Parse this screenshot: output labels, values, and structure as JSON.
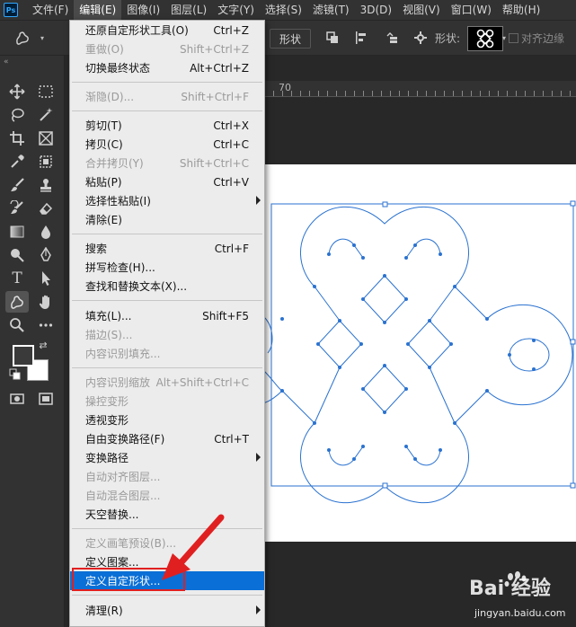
{
  "menubar": {
    "app_icon": "ps",
    "items": [
      "文件(F)",
      "编辑(E)",
      "图像(I)",
      "图层(L)",
      "文字(Y)",
      "选择(S)",
      "滤镜(T)",
      "3D(D)",
      "视图(V)",
      "窗口(W)",
      "帮助(H)"
    ],
    "active_index": 1
  },
  "options": {
    "shape_button": "形状",
    "shape_label": "形状:",
    "align_edges": "对齐边缘"
  },
  "ruler": {
    "number": "70"
  },
  "edit_menu": {
    "items": [
      {
        "label": "还原自定形状工具(O)",
        "shortcut": "Ctrl+Z",
        "disabled": false
      },
      {
        "label": "重做(O)",
        "shortcut": "Shift+Ctrl+Z",
        "disabled": true
      },
      {
        "label": "切换最终状态",
        "shortcut": "Alt+Ctrl+Z",
        "disabled": false
      },
      {
        "label": "渐隐(D)...",
        "shortcut": "Shift+Ctrl+F",
        "disabled": true
      },
      {
        "label": "剪切(T)",
        "shortcut": "Ctrl+X",
        "disabled": false
      },
      {
        "label": "拷贝(C)",
        "shortcut": "Ctrl+C",
        "disabled": false
      },
      {
        "label": "合并拷贝(Y)",
        "shortcut": "Shift+Ctrl+C",
        "disabled": true
      },
      {
        "label": "粘贴(P)",
        "shortcut": "Ctrl+V",
        "disabled": false
      },
      {
        "label": "选择性粘贴(I)",
        "shortcut": "",
        "disabled": false,
        "submenu": true
      },
      {
        "label": "清除(E)",
        "shortcut": "",
        "disabled": false
      },
      {
        "label": "搜索",
        "shortcut": "Ctrl+F",
        "disabled": false
      },
      {
        "label": "拼写检查(H)...",
        "shortcut": "",
        "disabled": false
      },
      {
        "label": "查找和替换文本(X)...",
        "shortcut": "",
        "disabled": false
      },
      {
        "label": "填充(L)...",
        "shortcut": "Shift+F5",
        "disabled": false
      },
      {
        "label": "描边(S)...",
        "shortcut": "",
        "disabled": true
      },
      {
        "label": "内容识别填充...",
        "shortcut": "",
        "disabled": true
      },
      {
        "label": "内容识别缩放",
        "shortcut": "Alt+Shift+Ctrl+C",
        "disabled": true
      },
      {
        "label": "操控变形",
        "shortcut": "",
        "disabled": true
      },
      {
        "label": "透视变形",
        "shortcut": "",
        "disabled": false
      },
      {
        "label": "自由变换路径(F)",
        "shortcut": "Ctrl+T",
        "disabled": false
      },
      {
        "label": "变换路径",
        "shortcut": "",
        "disabled": false,
        "submenu": true
      },
      {
        "label": "自动对齐图层...",
        "shortcut": "",
        "disabled": true
      },
      {
        "label": "自动混合图层...",
        "shortcut": "",
        "disabled": true
      },
      {
        "label": "天空替换...",
        "shortcut": "",
        "disabled": false
      },
      {
        "label": "定义画笔预设(B)...",
        "shortcut": "",
        "disabled": true
      },
      {
        "label": "定义图案...",
        "shortcut": "",
        "disabled": false
      },
      {
        "label": "定义自定形状...",
        "shortcut": "",
        "disabled": false,
        "highlight": true
      },
      {
        "label": "清理(R)",
        "shortcut": "",
        "disabled": false,
        "submenu": true
      }
    ]
  },
  "watermark": {
    "logo_text": "Bai 经验",
    "url": "jingyan.baidu.com"
  },
  "colors": {
    "highlight": "#0a6fd6",
    "path_stroke": "#2a72d0",
    "annotation_red": "#e02020"
  }
}
